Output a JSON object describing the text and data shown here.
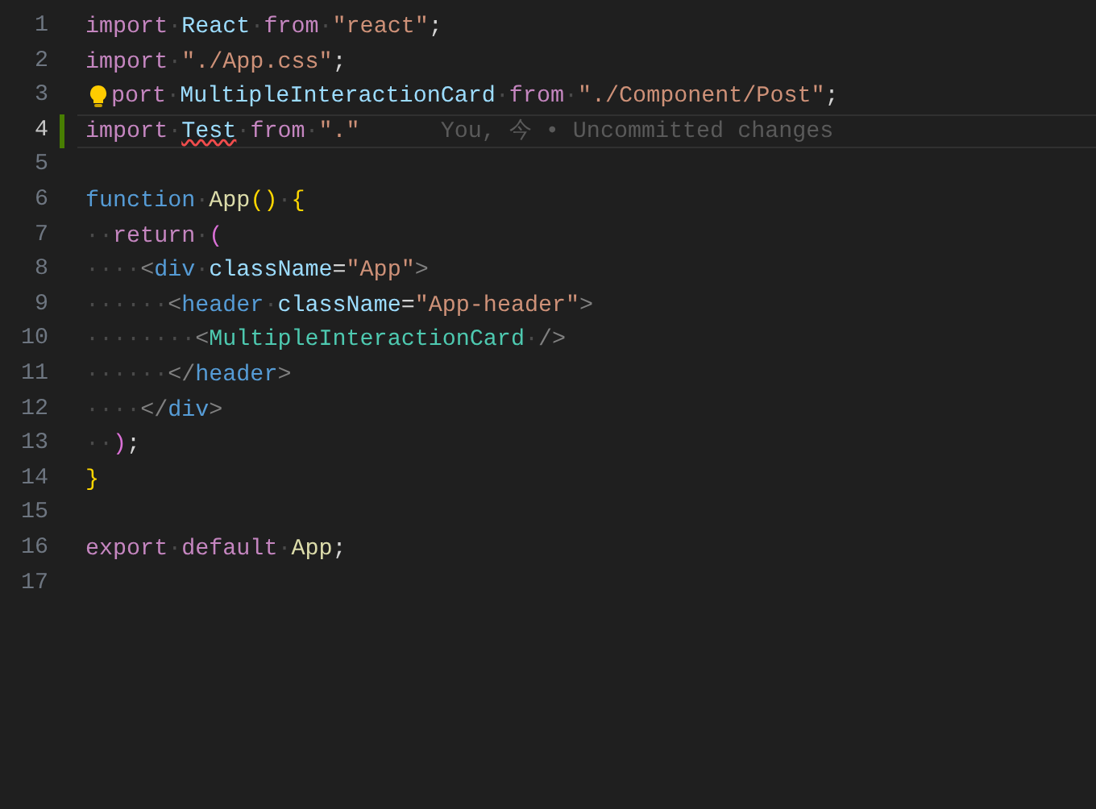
{
  "lines": [
    {
      "number": "1",
      "current": false,
      "modified": false,
      "lightbulb": false,
      "tokens": [
        {
          "kind": "keyword",
          "text": "import"
        },
        {
          "kind": "space",
          "text": "·"
        },
        {
          "kind": "variable",
          "text": "React"
        },
        {
          "kind": "space",
          "text": "·"
        },
        {
          "kind": "keyword",
          "text": "from"
        },
        {
          "kind": "space",
          "text": "·"
        },
        {
          "kind": "string",
          "text": "\"react\""
        },
        {
          "kind": "plain",
          "text": ";"
        }
      ]
    },
    {
      "number": "2",
      "current": false,
      "modified": false,
      "lightbulb": false,
      "tokens": [
        {
          "kind": "keyword",
          "text": "import"
        },
        {
          "kind": "space",
          "text": "·"
        },
        {
          "kind": "string",
          "text": "\"./App.css\""
        },
        {
          "kind": "plain",
          "text": ";"
        }
      ]
    },
    {
      "number": "3",
      "current": false,
      "modified": false,
      "lightbulb": true,
      "tokens": [
        {
          "kind": "keyword",
          "text": "port"
        },
        {
          "kind": "space",
          "text": "·"
        },
        {
          "kind": "variable",
          "text": "MultipleInteractionCard"
        },
        {
          "kind": "space",
          "text": "·"
        },
        {
          "kind": "keyword",
          "text": "from"
        },
        {
          "kind": "space",
          "text": "·"
        },
        {
          "kind": "string",
          "text": "\"./Component/Post\""
        },
        {
          "kind": "plain",
          "text": ";"
        }
      ]
    },
    {
      "number": "4",
      "current": true,
      "modified": true,
      "lightbulb": false,
      "blame": "You, 今 • Uncommitted changes",
      "tokens": [
        {
          "kind": "keyword",
          "text": "import"
        },
        {
          "kind": "space",
          "text": "·"
        },
        {
          "kind": "variable",
          "text": "Test",
          "error": true
        },
        {
          "kind": "space",
          "text": "·"
        },
        {
          "kind": "keyword",
          "text": "from"
        },
        {
          "kind": "space",
          "text": "·"
        },
        {
          "kind": "string",
          "text": "\".\""
        }
      ]
    },
    {
      "number": "5",
      "current": false,
      "modified": false,
      "lightbulb": false
    },
    {
      "number": "6",
      "current": false,
      "modified": false,
      "lightbulb": false,
      "tokens": [
        {
          "kind": "storage",
          "text": "function"
        },
        {
          "kind": "space",
          "text": "·"
        },
        {
          "kind": "function",
          "text": "App"
        },
        {
          "kind": "bracket",
          "text": "()"
        },
        {
          "kind": "space",
          "text": "·"
        },
        {
          "kind": "bracket",
          "text": "{"
        }
      ]
    },
    {
      "number": "7",
      "current": false,
      "modified": false,
      "lightbulb": false,
      "tokens": [
        {
          "kind": "space",
          "text": "··"
        },
        {
          "kind": "keyword",
          "text": "return"
        },
        {
          "kind": "space",
          "text": "·"
        },
        {
          "kind": "bracket2",
          "text": "("
        }
      ]
    },
    {
      "number": "8",
      "current": false,
      "modified": false,
      "lightbulb": false,
      "tokens": [
        {
          "kind": "space",
          "text": "····"
        },
        {
          "kind": "tagpunct",
          "text": "<"
        },
        {
          "kind": "tag",
          "text": "div"
        },
        {
          "kind": "space",
          "text": "·"
        },
        {
          "kind": "variable",
          "text": "className"
        },
        {
          "kind": "plain",
          "text": "="
        },
        {
          "kind": "string",
          "text": "\"App\""
        },
        {
          "kind": "tagpunct",
          "text": ">"
        }
      ]
    },
    {
      "number": "9",
      "current": false,
      "modified": false,
      "lightbulb": false,
      "tokens": [
        {
          "kind": "space",
          "text": "······"
        },
        {
          "kind": "tagpunct",
          "text": "<"
        },
        {
          "kind": "tag",
          "text": "header"
        },
        {
          "kind": "space",
          "text": "·"
        },
        {
          "kind": "variable",
          "text": "className"
        },
        {
          "kind": "plain",
          "text": "="
        },
        {
          "kind": "string",
          "text": "\"App-header\""
        },
        {
          "kind": "tagpunct",
          "text": ">"
        }
      ]
    },
    {
      "number": "10",
      "current": false,
      "modified": false,
      "lightbulb": false,
      "tokens": [
        {
          "kind": "space",
          "text": "········"
        },
        {
          "kind": "tagpunct",
          "text": "<"
        },
        {
          "kind": "component",
          "text": "MultipleInteractionCard"
        },
        {
          "kind": "space",
          "text": "·"
        },
        {
          "kind": "tagpunct",
          "text": "/>"
        }
      ]
    },
    {
      "number": "11",
      "current": false,
      "modified": false,
      "lightbulb": false,
      "tokens": [
        {
          "kind": "space",
          "text": "······"
        },
        {
          "kind": "tagpunct",
          "text": "</"
        },
        {
          "kind": "tag",
          "text": "header"
        },
        {
          "kind": "tagpunct",
          "text": ">"
        }
      ]
    },
    {
      "number": "12",
      "current": false,
      "modified": false,
      "lightbulb": false,
      "tokens": [
        {
          "kind": "space",
          "text": "····"
        },
        {
          "kind": "tagpunct",
          "text": "</"
        },
        {
          "kind": "tag",
          "text": "div"
        },
        {
          "kind": "tagpunct",
          "text": ">"
        }
      ]
    },
    {
      "number": "13",
      "current": false,
      "modified": false,
      "lightbulb": false,
      "tokens": [
        {
          "kind": "space",
          "text": "··"
        },
        {
          "kind": "bracket2",
          "text": ")"
        },
        {
          "kind": "plain",
          "text": ";"
        }
      ]
    },
    {
      "number": "14",
      "current": false,
      "modified": false,
      "lightbulb": false,
      "tokens": [
        {
          "kind": "bracket",
          "text": "}"
        }
      ]
    },
    {
      "number": "15",
      "current": false,
      "modified": false,
      "lightbulb": false
    },
    {
      "number": "16",
      "current": false,
      "modified": false,
      "lightbulb": false,
      "tokens": [
        {
          "kind": "keyword",
          "text": "export"
        },
        {
          "kind": "space",
          "text": "·"
        },
        {
          "kind": "keyword",
          "text": "default"
        },
        {
          "kind": "space",
          "text": "·"
        },
        {
          "kind": "function",
          "text": "App"
        },
        {
          "kind": "plain",
          "text": ";"
        }
      ]
    },
    {
      "number": "17",
      "current": false,
      "modified": false,
      "lightbulb": false
    }
  ]
}
